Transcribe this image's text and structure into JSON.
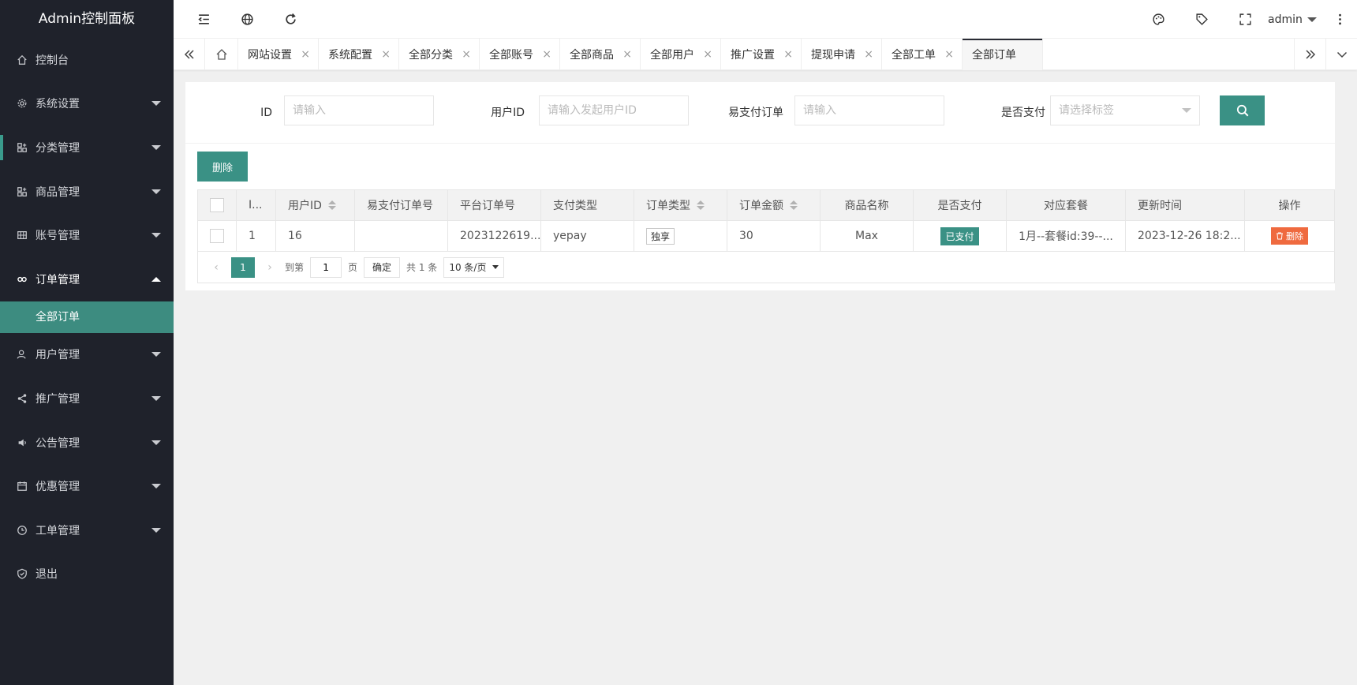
{
  "app": {
    "title": "Admin控制面板"
  },
  "sidebar": {
    "items": [
      {
        "label": "控制台",
        "icon": "home-icon"
      },
      {
        "label": "系统设置",
        "icon": "gear-icon"
      },
      {
        "label": "分类管理",
        "icon": "apps-icon"
      },
      {
        "label": "商品管理",
        "icon": "apps-icon"
      },
      {
        "label": "账号管理",
        "icon": "grid-icon"
      },
      {
        "label": "订单管理",
        "icon": "link-icon"
      },
      {
        "label": "用户管理",
        "icon": "user-icon"
      },
      {
        "label": "推广管理",
        "icon": "share-icon"
      },
      {
        "label": "公告管理",
        "icon": "speaker-icon"
      },
      {
        "label": "优惠管理",
        "icon": "calendar-icon"
      },
      {
        "label": "工单管理",
        "icon": "clock-icon"
      },
      {
        "label": "退出",
        "icon": "shield-icon"
      }
    ],
    "sub_item": "全部订单"
  },
  "header": {
    "user": "admin"
  },
  "tabs": [
    {
      "label": "网站设置"
    },
    {
      "label": "系统配置"
    },
    {
      "label": "全部分类"
    },
    {
      "label": "全部账号"
    },
    {
      "label": "全部商品"
    },
    {
      "label": "全部用户"
    },
    {
      "label": "推广设置"
    },
    {
      "label": "提现申请"
    },
    {
      "label": "全部工单"
    },
    {
      "label": "全部订单"
    }
  ],
  "tab_close": "×",
  "filters": {
    "id_label": "ID",
    "id_placeholder": "请输入",
    "user_label": "用户ID",
    "user_placeholder": "请输入发起用户ID",
    "epay_label": "易支付订单",
    "epay_placeholder": "请输入",
    "paid_label": "是否支付",
    "paid_placeholder": "请选择标签"
  },
  "toolbar": {
    "delete_label": "删除"
  },
  "table": {
    "headers": [
      "I...",
      "用户ID",
      "易支付订单号",
      "平台订单号",
      "支付类型",
      "订单类型",
      "订单金额",
      "商品名称",
      "是否支付",
      "对应套餐",
      "更新时间",
      "操作"
    ],
    "rows": [
      {
        "id": "1",
        "user_id": "16",
        "epay_no": "",
        "platform_no": "2023122619...",
        "pay_type": "yepay",
        "order_type": "独享",
        "amount": "30",
        "product": "Max",
        "paid": "已支付",
        "package": "1月--套餐id:39--...",
        "updated": "2023-12-26 18:2...",
        "action": "删除"
      }
    ]
  },
  "pagination": {
    "current": "1",
    "goto_label": "到第",
    "goto_value": "1",
    "page_label": "页",
    "confirm": "确定",
    "total": "共 1 条",
    "page_size": "10 条/页"
  },
  "colors": {
    "primary": "#3a9185",
    "sidebar_bg": "#1f222b",
    "danger": "#ef6a3f"
  }
}
